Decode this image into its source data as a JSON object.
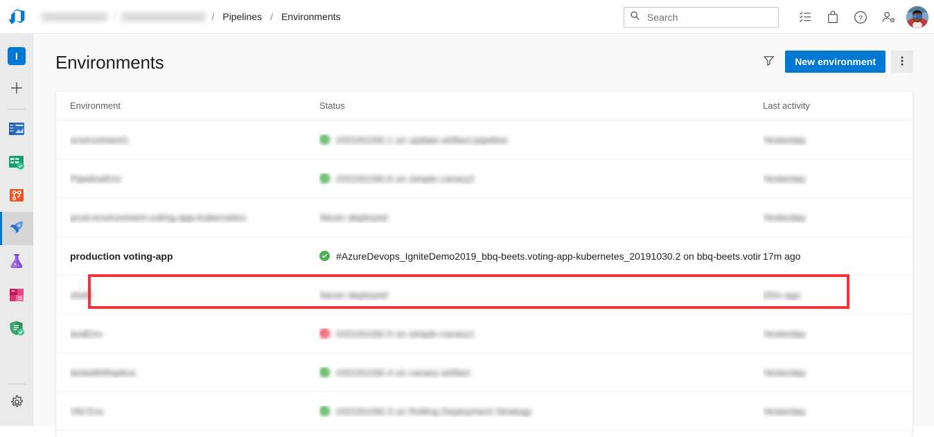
{
  "topbar": {
    "logo": "azure-devops-logo",
    "breadcrumb": [
      {
        "label": "Ignite Demo",
        "redacted": true
      },
      {
        "label": "igniteDemo2019",
        "redacted": true
      },
      {
        "label": "Pipelines",
        "redacted": false
      },
      {
        "label": "Environments",
        "redacted": false
      }
    ],
    "search": {
      "value": "",
      "placeholder": "Search"
    },
    "icons": [
      {
        "name": "task-list-icon",
        "glyph": "list"
      },
      {
        "name": "marketplace-bag-icon",
        "glyph": "bag"
      },
      {
        "name": "help-icon",
        "glyph": "question"
      },
      {
        "name": "user-settings-icon",
        "glyph": "person-gear"
      }
    ],
    "avatar_label": "User profile"
  },
  "rail": {
    "project_initial": "I",
    "items": [
      {
        "name": "project-avatar",
        "label": "I"
      },
      {
        "name": "create-new",
        "label": "+"
      },
      {
        "name": "overview",
        "label": "Overview"
      },
      {
        "name": "boards",
        "label": "Boards"
      },
      {
        "name": "repos",
        "label": "Repos"
      },
      {
        "name": "pipelines",
        "label": "Pipelines",
        "selected": true
      },
      {
        "name": "test-plans",
        "label": "Test Plans"
      },
      {
        "name": "artifacts",
        "label": "Artifacts"
      },
      {
        "name": "security",
        "label": "Security"
      },
      {
        "name": "project-settings",
        "label": "Project settings"
      }
    ]
  },
  "page": {
    "title": "Environments",
    "filter_label": "Filter",
    "new_environment_label": "New environment",
    "more_options_label": "More options"
  },
  "table": {
    "columns": [
      "Environment",
      "Status",
      "Last activity"
    ],
    "rows": [
      {
        "environment": "environment1",
        "status_icon": "green",
        "status": "#20191030.1 on update-artifact-pipeline",
        "activity": "Yesterday",
        "redacted": true,
        "highlighted": false
      },
      {
        "environment": "PipelineEnv",
        "status_icon": "green",
        "status": "#20191030.6 on simple-canary2",
        "activity": "Yesterday",
        "redacted": true,
        "highlighted": false
      },
      {
        "environment": "prod-environment-voting-app-kubernetes",
        "status_icon": "none",
        "status": "Never deployed",
        "activity": "Yesterday",
        "redacted": true,
        "highlighted": false
      },
      {
        "environment": "production voting-app",
        "status_icon": "green",
        "status": "#AzureDevops_IgniteDemo2019_bbq-beets.voting-app-kubernetes_20191030.2 on bbq-beets.votir",
        "activity": "17m ago",
        "redacted": false,
        "highlighted": true
      },
      {
        "environment": "shelli",
        "status_icon": "none",
        "status": "Never deployed",
        "activity": "20m ago",
        "redacted": true,
        "highlighted": false
      },
      {
        "environment": "testEnv",
        "status_icon": "red",
        "status": "#20191030.5 on simple-canary1",
        "activity": "Yesterday",
        "redacted": true,
        "highlighted": false
      },
      {
        "environment": "testwithReplica",
        "status_icon": "green",
        "status": "#20191030.4 on canary-artifact",
        "activity": "Yesterday",
        "redacted": true,
        "highlighted": false
      },
      {
        "environment": "VM Env",
        "status_icon": "green",
        "status": "#20191030.3 on Rolling Deployment Strategy",
        "activity": "Yesterday",
        "redacted": true,
        "highlighted": false
      }
    ]
  },
  "annotation": {
    "type": "highlight-rectangle",
    "color": "#f0323c",
    "target_row": "production voting-app"
  }
}
